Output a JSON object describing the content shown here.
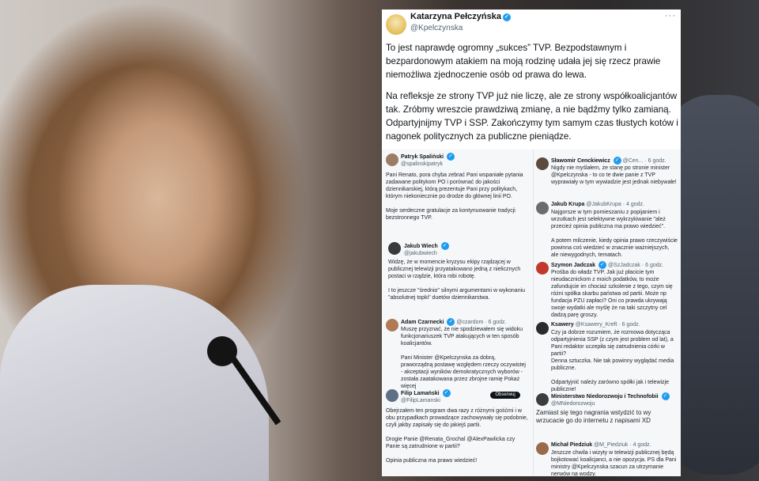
{
  "tweet": {
    "author_name": "Katarzyna Pełczyńska",
    "author_handle": "@Kpelczynska",
    "more_label": "···",
    "paragraphs": [
      "To jest naprawdę ogromny „sukces” TVP.  Bezpodstawnym i bezpardonowym atakiem na moją rodzinę udała jej się rzecz prawie niemożliwa zjednoczenie osób od prawa do lewa.",
      "Na refleksje ze strony TVP już nie liczę, ale ze strony współkoalicjantów tak. Zróbmy wreszcie prawdziwą zmianę, a nie bądźmy tylko zamianą. Odpartyjnijmy TVP i SSP. Zakończymy tym samym czas tłustych kotów i nagonek politycznych za publiczne pieniądze."
    ]
  },
  "replies_left": [
    {
      "name": "Patryk Spaliński",
      "handle": "@spalinskipatryk",
      "text": "Pani Renato, pora chyba zebrać Pani wspaniałe pytania zadawane politykom PO i porównać do jakości dziennikarskiej, którą prezentuje Pani przy politykach, którym niekoniecznie po drodze do głównej linii PO.\n\nMoje serdeczne gratulacje za kontynuowanie tradycji bezstronnego TVP."
    },
    {
      "name": "Jakub Wiech",
      "handle": "@jakubwiech",
      "text": "Widzę, że w momencie kryzysu ekipy rządzącej w publicznej telewizji przyatakowano jedną z nielicznych postaci w rządzie, która robi robotę.\n\nI to jeszcze \"średnio\" silnymi argumentami w wykonaniu \"absolutnej topki\" duetów dziennikarstwa."
    },
    {
      "name": "Adam Czarnecki",
      "handle": "@czardom · 6 godz.",
      "text": "Muszę przyznać, że nie spodziewałem się widoku funkcjonariuszek TVP atakujących w ten sposób koalicjantów.\n\nPani Minister @Kpelczynska za dobrą, praworządną postawę względem rzeczy oczywistej - akceptacji wyników demokratycznych wyborów - została zaatakowana przez zbrojne ramię Pokaż więcej"
    },
    {
      "name": "Filip Lamański",
      "handle": "@FilipLamanski",
      "follow": "Obserwuj",
      "text": "Obejrzałem ten program dwa razy z różnymi gośćmi i w obu przypadkach prowadzące zachowywały się podobnie, czyli jakby zapisały się do jakiejś partii.\n\nDrogie Panie @Renata_Grochal @AlexPawlicka czy Panie są zatrudnione w partii?\n\nOpinia publiczna ma prawo wiedzieć!"
    }
  ],
  "replies_right": [
    {
      "name": "Sławomir Cenckiewicz",
      "handle": "@Cen... · 6 godz.",
      "text": "Nigdy nie myślałem, że stanę po stronie minister @Kpelczynska - to co te dwie panie z TVP wyprawiały w tym wywiadzie jest jednak niebywałe!"
    },
    {
      "name": "Jakub Krupa",
      "handle": "@JakubKrupa · 4 godz.",
      "text": "Najgorsze w tym pomieszaniu z popijaniem i wrzutkach jest selektywne wykrzykiwanie \"ależ przecież opinia publiczna ma prawo wiedzieć\".\n\nA potem milczenie, kiedy opinia prawo rzeczywiście powinna coś wiedzieć w znacznie ważniejszych, ale niewygodnych, tematach."
    },
    {
      "name": "Szymon Jadczak",
      "handle": "@SzJadczak · 6 godz.",
      "text": "Prośba do władz TVP. Jak już płacicie tym nieudacznickom z moich podatków, to może zafundujcie im chociaż szkolenie z tego, czym się różni spółka skarbu państwa od partii. Może np fundacja PZU zapłaci? Oni co prawda ukrywają swoje wydatki ale myślę że na taki szczytny cel dadzą parę groszy."
    },
    {
      "name": "Ksawery",
      "handle": "@Ksawery_Kreft · 6 godz.",
      "text": "Czy ja dobrze rozumiem, że rozmowa dotycząca odpartyjnienia SSP (z czym jest problem od lat), a Pani redaktor uczepiła się zatrudnienia córki w partii?\nDenna sztuczka. Nie tak powinny wyglądać media publiczne.\n\nOdpartyjnić należy zarówno spółki jak i telewizje publiczne!"
    },
    {
      "name": "Ministerstwo Niedorozwoju i Technofobii",
      "handle": "@MNiedorozwoju",
      "text": "Zamiast się tego nagrania wstydzić to wy wrzucacie go do internetu z napisami XD"
    },
    {
      "name": "Michał Piedziuk",
      "handle": "@M_Piedziuk · 4 godz.",
      "text": "Jeszcze chwila i wizyty w telewizji publicznej będą bojkotować koalicjanci, a nie opozycja. PS dla Pani ministry @Kpelczynska szacun za utrzymanie nerwów na wodzy."
    }
  ]
}
